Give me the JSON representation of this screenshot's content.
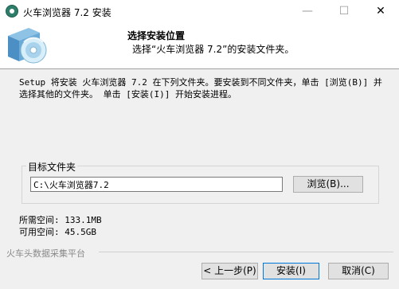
{
  "window": {
    "title": "火车浏览器 7.2 安装",
    "minimize_glyph": "—",
    "maximize_glyph": "☐",
    "close_glyph": "✕"
  },
  "header": {
    "title": "选择安装位置",
    "subtitle": "选择“火车浏览器 7.2”的安装文件夹。"
  },
  "description": "Setup 将安装 火车浏览器 7.2 在下列文件夹。要安装到不同文件夹，单击 [浏览(B)] 并选择其他的文件夹。 单击 [安装(I)] 开始安装进程。",
  "destination": {
    "label": "目标文件夹",
    "path": "C:\\火车浏览器7.2",
    "browse_label": "浏览(B)..."
  },
  "space": {
    "required": "所需空间: 133.1MB",
    "available": "可用空间: 45.5GB"
  },
  "footer": {
    "brand": "火车头数据采集平台",
    "back_label": "< 上一步(P)",
    "install_label": "安装(I)",
    "cancel_label": "取消(C)"
  }
}
